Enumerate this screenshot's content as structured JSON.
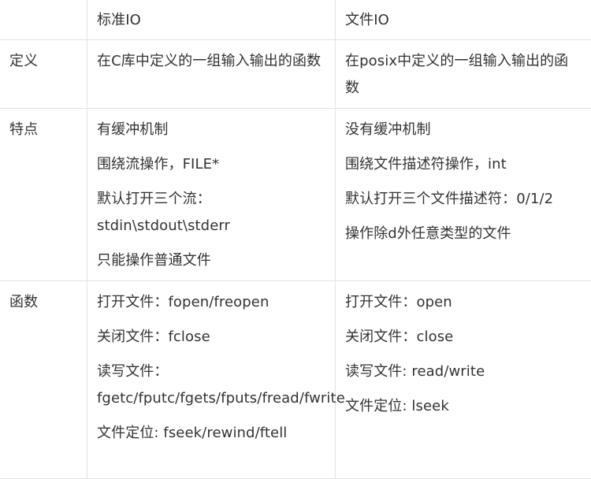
{
  "table": {
    "headers": [
      "",
      "标准IO",
      "文件IO"
    ],
    "rows": [
      {
        "label": "定义",
        "std": [
          "在C库中定义的一组输入输出的函数"
        ],
        "file": [
          "在posix中定义的一组输入输出的函数"
        ]
      },
      {
        "label": "特点",
        "std": [
          "有缓冲机制",
          "围绕流操作，FILE*",
          "默认打开三个流：stdin\\stdout\\stderr",
          "只能操作普通文件"
        ],
        "file": [
          "没有缓冲机制",
          "围绕文件描述符操作，int",
          "默认打开三个文件描述符：0/1/2",
          "操作除d外任意类型的文件"
        ]
      },
      {
        "label": "函数",
        "std": [
          "打开文件：fopen/freopen",
          "关闭文件：fclose",
          "读写文件：fgetc/fputc/fgets/fputs/fread/fwrite",
          "文件定位: fseek/rewind/ftell"
        ],
        "file": [
          "打开文件：open",
          "关闭文件：close",
          "读写文件: read/write",
          "文件定位: lseek"
        ]
      }
    ]
  },
  "colors": {
    "border": "#e3e3e3",
    "text": "#333333",
    "background": "#ffffff"
  }
}
